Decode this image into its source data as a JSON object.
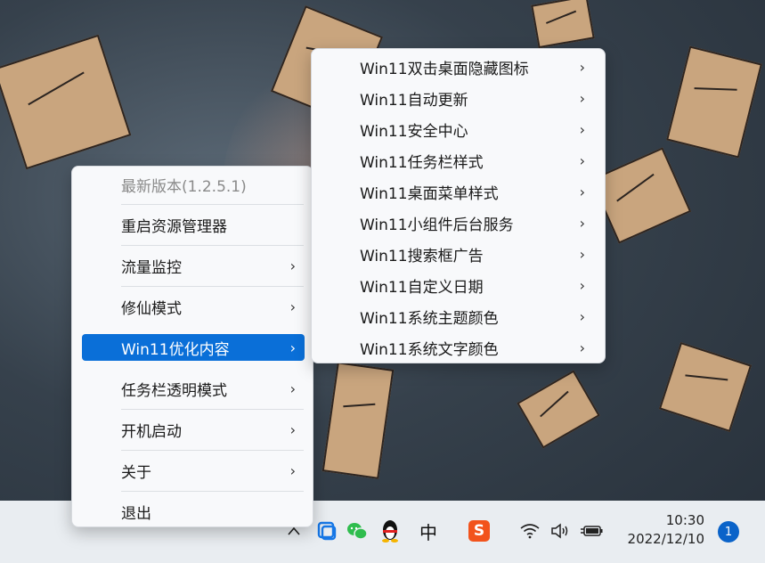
{
  "menu": {
    "version": "最新版本(1.2.5.1)",
    "items": [
      {
        "label": "重启资源管理器",
        "arrow": ""
      },
      {
        "label": "流量监控",
        "arrow": "›"
      },
      {
        "label": "修仙模式",
        "arrow": "›"
      },
      {
        "label": "Win11优化内容",
        "arrow": "›"
      },
      {
        "label": "任务栏透明模式",
        "arrow": "›"
      },
      {
        "label": "开机启动",
        "arrow": "›"
      },
      {
        "label": "关于",
        "arrow": "›"
      },
      {
        "label": "退出",
        "arrow": ""
      }
    ]
  },
  "submenu": {
    "items": [
      {
        "label": "Win11双击桌面隐藏图标",
        "arrow": "›"
      },
      {
        "label": "Win11自动更新",
        "arrow": "›"
      },
      {
        "label": "Win11安全中心",
        "arrow": "›"
      },
      {
        "label": "Win11任务栏样式",
        "arrow": "›"
      },
      {
        "label": "Win11桌面菜单样式",
        "arrow": "›"
      },
      {
        "label": "Win11小组件后台服务",
        "arrow": "›"
      },
      {
        "label": "Win11搜索框广告",
        "arrow": "›"
      },
      {
        "label": "Win11自定义日期",
        "arrow": "›"
      },
      {
        "label": "Win11系统主题颜色",
        "arrow": "›"
      },
      {
        "label": "Win11系统文字颜色",
        "arrow": "›"
      }
    ]
  },
  "taskbar": {
    "chevron": "^",
    "ime": "中",
    "sogou": "S",
    "time": "10:30",
    "date": "2022/12/10",
    "notification_count": "1",
    "icons": [
      "chevron-up-icon",
      "app-square-icon",
      "wechat-icon",
      "qq-penguin-icon",
      "ime-icon",
      "sogou-icon",
      "wifi-icon",
      "volume-icon",
      "battery-icon"
    ]
  },
  "colors": {
    "highlight": "#0a6fd8",
    "menu_bg": "#f8f9fb",
    "notif": "#0a63c9"
  }
}
